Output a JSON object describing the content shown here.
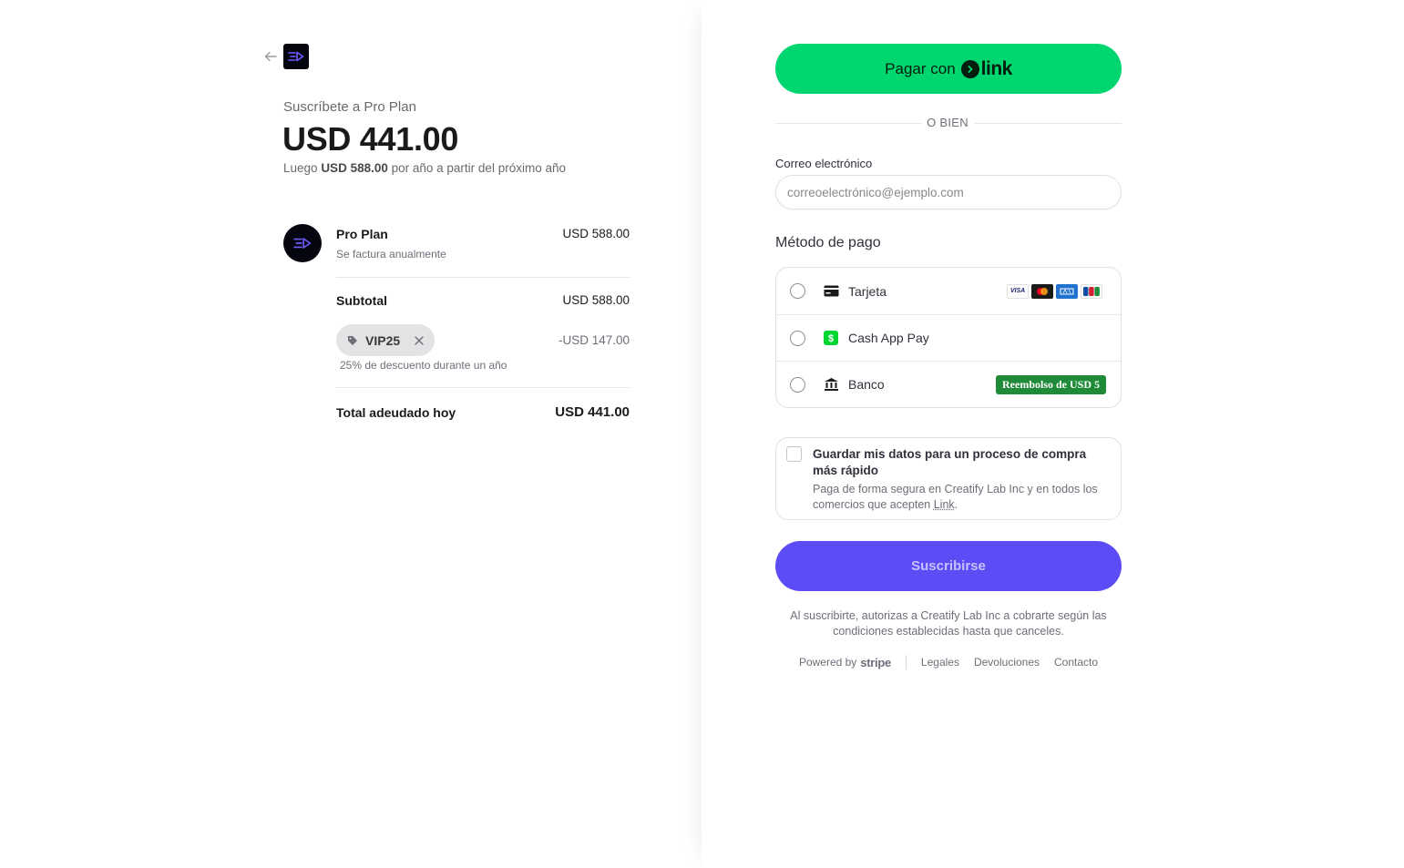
{
  "summary": {
    "subscribe_label": "Suscríbete a Pro Plan",
    "price_today": "USD 441.00",
    "after_prefix": "Luego",
    "after_amount": "USD 588.00",
    "after_suffix": "por año a partir del próximo año"
  },
  "line_item": {
    "name": "Pro Plan",
    "billing": "Se factura anualmente",
    "price": "USD 588.00"
  },
  "subtotal": {
    "label": "Subtotal",
    "value": "USD 588.00"
  },
  "promo": {
    "code": "VIP25",
    "discount": "-USD 147.00",
    "description": "25% de descuento durante un año"
  },
  "total": {
    "label": "Total adeudado hoy",
    "value": "USD 441.00"
  },
  "link_button": {
    "label": "Pagar con",
    "brand": "link"
  },
  "divider_text": "O BIEN",
  "email": {
    "label": "Correo electrónico",
    "placeholder": "correoelectrónico@ejemplo.com"
  },
  "payment": {
    "title": "Método de pago",
    "methods": [
      {
        "label": "Tarjeta",
        "icon": "card-icon"
      },
      {
        "label": "Cash App Pay",
        "icon": "cash-app-icon"
      },
      {
        "label": "Banco",
        "icon": "bank-icon",
        "badge": "Reembolso de USD 5"
      }
    ],
    "card_brands": [
      "VISA",
      "Mastercard",
      "AMEX",
      "JCB"
    ]
  },
  "save_info": {
    "title": "Guardar mis datos para un proceso de compra más rápido",
    "desc_prefix": "Paga de forma segura en Creatify Lab Inc y en todos los comercios que acepten",
    "desc_link": "Link",
    "desc_suffix": "."
  },
  "subscribe_button": "Suscribirse",
  "legal": "Al suscribirte, autorizas a Creatify Lab Inc a cobrarte según las condiciones establecidas hasta que canceles.",
  "footer": {
    "powered_by": "Powered by",
    "brand": "stripe",
    "links": [
      "Legales",
      "Devoluciones",
      "Contacto"
    ]
  },
  "colors": {
    "link_green": "#00d66f",
    "primary": "#5b4cf5",
    "badge_green": "#1f8a37"
  }
}
